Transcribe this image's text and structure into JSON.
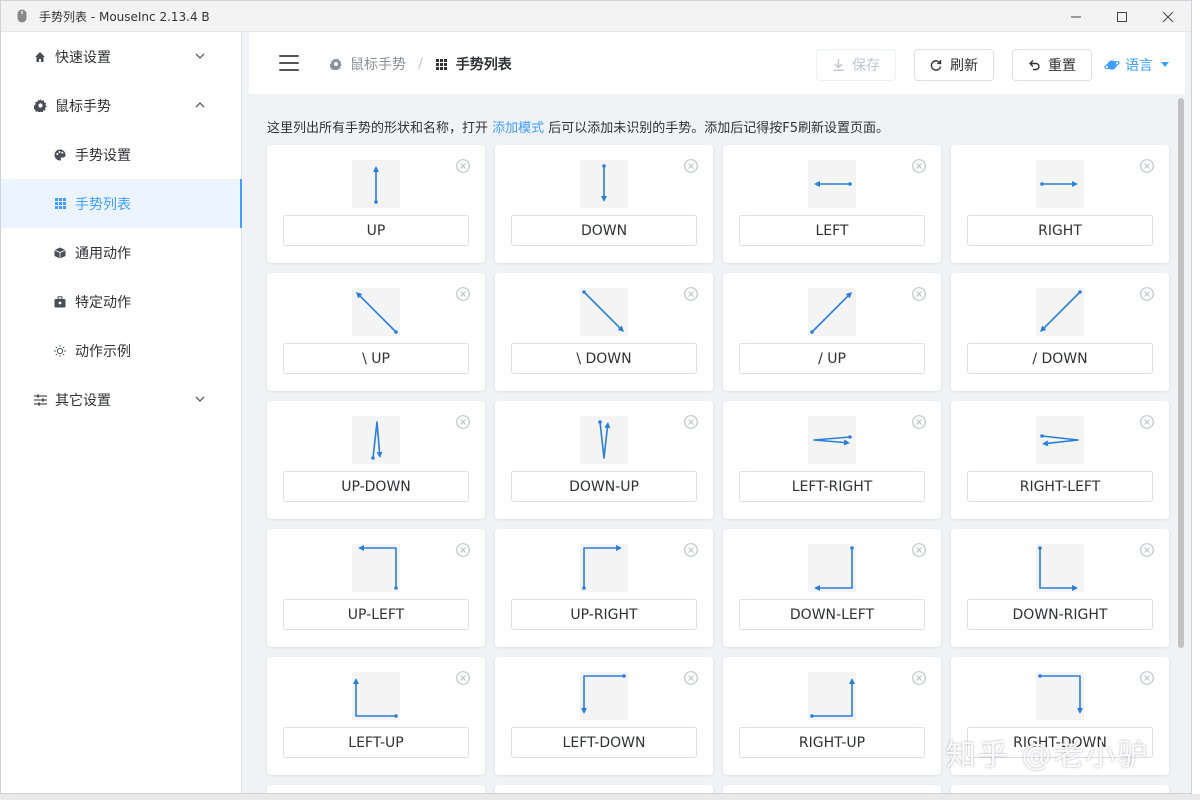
{
  "window": {
    "title": "手势列表 - MouseInc 2.13.4 B"
  },
  "sidebar": {
    "items": [
      {
        "label": "快速设置",
        "icon": "home-icon",
        "level": "top",
        "chevron": "down"
      },
      {
        "label": "鼠标手势",
        "icon": "gear-icon",
        "level": "top",
        "chevron": "up"
      },
      {
        "label": "手势设置",
        "icon": "palette-icon",
        "level": "sub"
      },
      {
        "label": "手势列表",
        "icon": "grid-icon",
        "level": "sub",
        "active": true
      },
      {
        "label": "通用动作",
        "icon": "cube-icon",
        "level": "sub"
      },
      {
        "label": "特定动作",
        "icon": "briefcase-icon",
        "level": "sub"
      },
      {
        "label": "动作示例",
        "icon": "bulb-icon",
        "level": "sub"
      },
      {
        "label": "其它设置",
        "icon": "sliders-icon",
        "level": "top",
        "chevron": "down"
      }
    ]
  },
  "header": {
    "breadcrumb": [
      {
        "label": "鼠标手势",
        "icon": "gear-icon"
      },
      {
        "label": "手势列表",
        "icon": "grid-icon"
      }
    ],
    "save_label": "保存",
    "refresh_label": "刷新",
    "reset_label": "重置",
    "language_label": "语言"
  },
  "tip": {
    "before": "这里列出所有手势的形状和名称，打开 ",
    "link": "添加模式",
    "after": " 后可以添加未识别的手势。添加后记得按F5刷新设置页面。"
  },
  "gestures": [
    {
      "name": "UP",
      "shape": "up"
    },
    {
      "name": "DOWN",
      "shape": "down"
    },
    {
      "name": "LEFT",
      "shape": "left"
    },
    {
      "name": "RIGHT",
      "shape": "right"
    },
    {
      "name": "\\ UP",
      "shape": "bs-up"
    },
    {
      "name": "\\ DOWN",
      "shape": "bs-down"
    },
    {
      "name": "/ UP",
      "shape": "fs-up"
    },
    {
      "name": "/ DOWN",
      "shape": "fs-down"
    },
    {
      "name": "UP-DOWN",
      "shape": "up-down"
    },
    {
      "name": "DOWN-UP",
      "shape": "down-up"
    },
    {
      "name": "LEFT-RIGHT",
      "shape": "left-right"
    },
    {
      "name": "RIGHT-LEFT",
      "shape": "right-left"
    },
    {
      "name": "UP-LEFT",
      "shape": "up-left"
    },
    {
      "name": "UP-RIGHT",
      "shape": "up-right"
    },
    {
      "name": "DOWN-LEFT",
      "shape": "down-left"
    },
    {
      "name": "DOWN-RIGHT",
      "shape": "down-right"
    },
    {
      "name": "LEFT-UP",
      "shape": "left-up"
    },
    {
      "name": "LEFT-DOWN",
      "shape": "left-down"
    },
    {
      "name": "RIGHT-UP",
      "shape": "right-up"
    },
    {
      "name": "RIGHT-DOWN",
      "shape": "right-down"
    }
  ],
  "watermark": "知乎 @老小驴",
  "colors": {
    "accent": "#409eff",
    "stroke": "#2b7fd9",
    "background": "#f0f2f5"
  }
}
